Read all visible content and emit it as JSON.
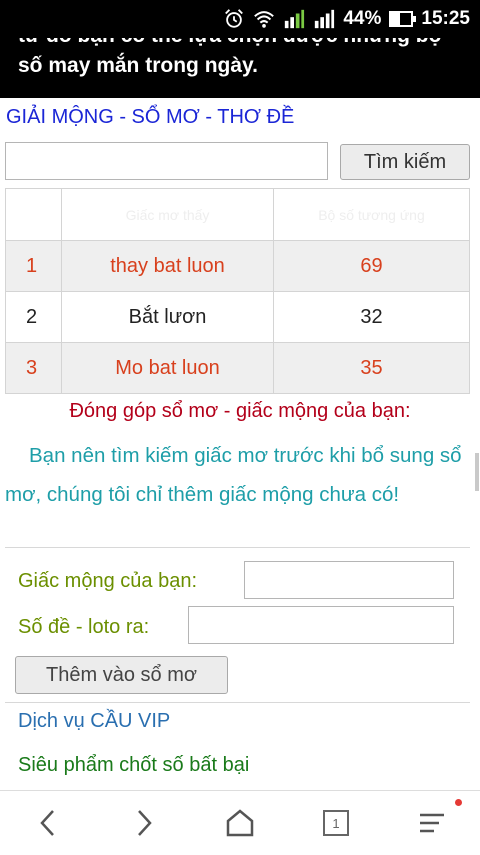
{
  "status_bar": {
    "battery": "44%",
    "time": "15:25",
    "icons": [
      "alarm-icon",
      "wifi-icon",
      "signal-sim1-icon",
      "signal-sim2-icon",
      "battery-icon"
    ]
  },
  "article": {
    "line_cut": "từ đó bạn có thể lựa chọn được những bộ",
    "line2": "số may mắn trong ngày."
  },
  "search": {
    "heading": "GIẢI MỘNG - SỔ MƠ - THƠ ĐỀ",
    "input_value": "",
    "button_label": "Tìm kiếm"
  },
  "results": {
    "headers": [
      "",
      "Giấc mơ thấy",
      "Bộ số tương ứng"
    ],
    "rows": [
      {
        "index": "1",
        "dream": "thay bat luon",
        "number": "69"
      },
      {
        "index": "2",
        "dream": "Bắt lươn",
        "number": "32"
      },
      {
        "index": "3",
        "dream": "Mo bat luon",
        "number": "35"
      }
    ]
  },
  "contribute": {
    "title": "Đóng góp sổ mơ - giấc mộng của bạn:",
    "note": "Bạn nên tìm kiếm giấc mơ trước khi bổ sung sổ mơ, chúng tôi chỉ thêm giấc mộng chưa có!",
    "dream_label": "Giấc mộng của bạn:",
    "dream_value": "",
    "number_label": "Số đề - loto ra:",
    "number_value": "",
    "add_button": "Thêm vào sổ mơ"
  },
  "links": {
    "vip": "Dịch vụ CẦU VIP",
    "promo": "Siêu phẩm chốt số bất bại"
  },
  "browser_nav": {
    "tab_count": "1",
    "icons": [
      "back-icon",
      "forward-icon",
      "home-icon",
      "tabs-icon",
      "menu-icon"
    ]
  }
}
